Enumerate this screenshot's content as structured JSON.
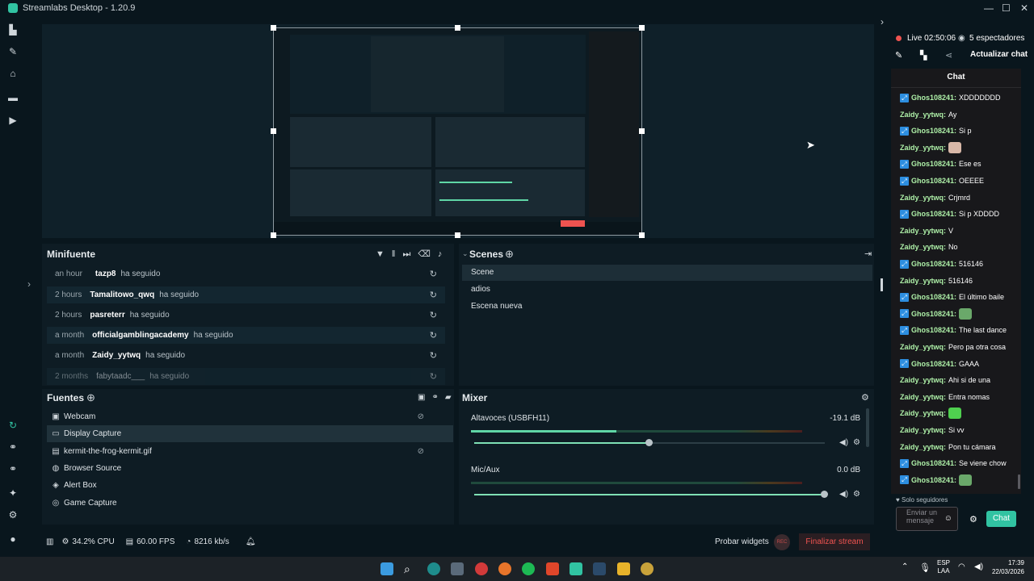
{
  "app": {
    "title": "Streamlabs Desktop - 1.20.9",
    "window_controls": [
      "—",
      "☐",
      "✕"
    ]
  },
  "minifuente": {
    "title": "Minifuente",
    "rows": [
      {
        "time": "an hour",
        "user": "tazp8",
        "action": "ha seguido"
      },
      {
        "time": "2 hours",
        "user": "Tamalitowo_qwq",
        "action": "ha seguido"
      },
      {
        "time": "2 hours",
        "user": "pasreterr",
        "action": "ha seguido"
      },
      {
        "time": "a month",
        "user": "officialgamblingacademy",
        "action": "ha seguido"
      },
      {
        "time": "a month",
        "user": "Zaidy_yytwq",
        "action": "ha seguido"
      },
      {
        "time": "2 months",
        "user": "fabytaadc___",
        "action": "ha seguido"
      }
    ]
  },
  "scenes": {
    "title": "Scenes",
    "items": [
      "Scene",
      "adios",
      "Escena nueva"
    ],
    "selected": "Scene"
  },
  "sources": {
    "title": "Fuentes",
    "items": [
      {
        "label": "Webcam",
        "icon": "camera-icon"
      },
      {
        "label": "Display Capture",
        "icon": "monitor-icon"
      },
      {
        "label": "kermit-the-frog-kermit.gif",
        "icon": "image-icon"
      },
      {
        "label": "Browser Source",
        "icon": "globe-icon"
      },
      {
        "label": "Alert Box",
        "icon": "alert-icon"
      },
      {
        "label": "Game Capture",
        "icon": "gamepad-icon"
      }
    ],
    "selected": "Display Capture"
  },
  "mixer": {
    "title": "Mixer",
    "channels": [
      {
        "name": "Altavoces (USBFH11)",
        "db": "-19.1 dB",
        "level": 0.5,
        "meter": 0.44
      },
      {
        "name": "Mic/Aux",
        "db": "0.0 dB",
        "level": 1.0,
        "meter": 0.0
      }
    ]
  },
  "footer": {
    "cpu": "34.2% CPU",
    "fps": "60.00 FPS",
    "bitrate": "8216 kb/s",
    "test_widgets": "Probar widgets",
    "rec": "REC",
    "end_stream": "Finalizar stream"
  },
  "live": {
    "status": "Live",
    "time": "02:50:06",
    "viewers": "5 espectadores",
    "update_chat": "Actualizar chat"
  },
  "chat": {
    "title": "Chat",
    "messages": [
      {
        "user": "Ghos108241:",
        "text": "XDDDDDDD",
        "badge": true
      },
      {
        "user": "Zaidy_yytwq:",
        "text": "Ay",
        "badge": false
      },
      {
        "user": "Ghos108241:",
        "text": "Si p",
        "badge": true
      },
      {
        "user": "Zaidy_yytwq:",
        "text": "",
        "badge": false,
        "emote": "cat"
      },
      {
        "user": "Ghos108241:",
        "text": "Ese es",
        "badge": true
      },
      {
        "user": "Ghos108241:",
        "text": "OEEEE",
        "badge": true
      },
      {
        "user": "Zaidy_yytwq:",
        "text": "Crjmrd",
        "badge": false
      },
      {
        "user": "Ghos108241:",
        "text": "Si p XDDDD",
        "badge": true
      },
      {
        "user": "Zaidy_yytwq:",
        "text": "V",
        "badge": false
      },
      {
        "user": "Zaidy_yytwq:",
        "text": "No",
        "badge": false
      },
      {
        "user": "Ghos108241:",
        "text": "516146",
        "badge": true
      },
      {
        "user": "Zaidy_yytwq:",
        "text": "516146",
        "badge": false
      },
      {
        "user": "Ghos108241:",
        "text": "El último baile",
        "badge": true
      },
      {
        "user": "Ghos108241:",
        "text": "",
        "badge": true,
        "emote": "frog"
      },
      {
        "user": "Ghos108241:",
        "text": "The last dance",
        "badge": true
      },
      {
        "user": "Zaidy_yytwq:",
        "text": "Pero pa otra cosa",
        "badge": false
      },
      {
        "user": "Ghos108241:",
        "text": "GAAA",
        "badge": true
      },
      {
        "user": "Zaidy_yytwq:",
        "text": "Ahi si de una",
        "badge": false
      },
      {
        "user": "Zaidy_yytwq:",
        "text": "Entra nomas",
        "badge": false
      },
      {
        "user": "Zaidy_yytwq:",
        "text": "",
        "badge": false,
        "emote": "green"
      },
      {
        "user": "Zaidy_yytwq:",
        "text": "Si vv",
        "badge": false
      },
      {
        "user": "Zaidy_yytwq:",
        "text": "Pon tu cámara",
        "badge": false
      },
      {
        "user": "Ghos108241:",
        "text": "Se viene chow",
        "badge": true
      },
      {
        "user": "Ghos108241:",
        "text": "",
        "badge": true,
        "emote": "frog"
      }
    ],
    "followers_only": "Solo seguidores",
    "input_placeholder": "Enviar un mensaje",
    "send": "Chat"
  },
  "tray": {
    "lang": "ESP",
    "lang2": "LAA",
    "time": "17:39",
    "date": "22/03/2026"
  },
  "colors": {
    "accent": "#31c3a2",
    "end_stream": "#ef5350",
    "chat_send": "#31c3a2"
  }
}
